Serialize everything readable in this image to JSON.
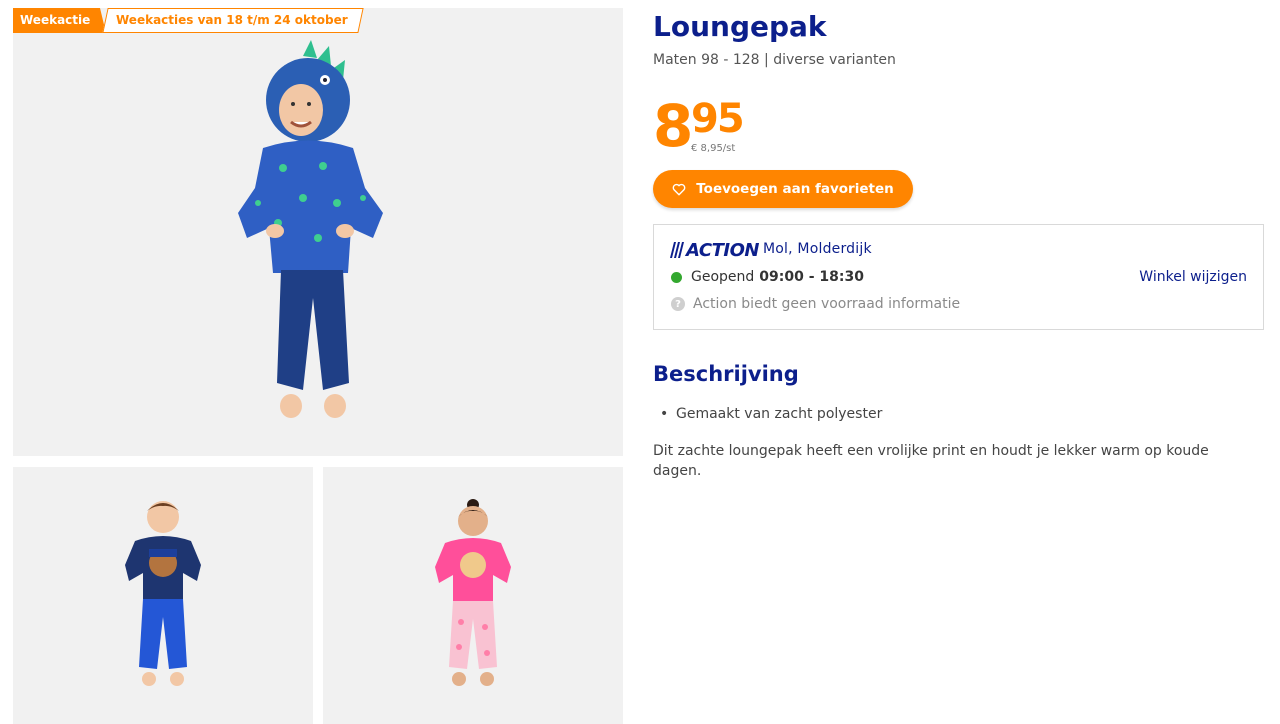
{
  "badges": {
    "weekactie": "Weekactie",
    "dates": "Weekacties van 18 t/m 24 oktober"
  },
  "product": {
    "title": "Loungepak",
    "subtitle": "Maten 98 - 128 | diverse varianten",
    "price_euros": "8",
    "price_cents": "95",
    "unit_price": "€ 8,95/st",
    "favorite_label": "Toevoegen aan favorieten"
  },
  "store": {
    "brand": "ACTION",
    "name": "Mol, Molderdijk",
    "status": "Geopend",
    "hours": "09:00 - 18:30",
    "change_label": "Winkel wijzigen",
    "stock_info": "Action biedt geen voorraad informatie"
  },
  "description": {
    "title": "Beschrijving",
    "bullets": [
      "Gemaakt van zacht polyester"
    ],
    "text": "Dit zachte loungepak heeft een vrolijke print en houdt je lekker warm op koude dagen."
  },
  "colors": {
    "accent": "#ff8500",
    "brand": "#0c1f8c",
    "open": "#34a82f"
  },
  "icons": {
    "favorite": "heart-outline-icon",
    "stock": "question-circle-icon",
    "open_status": "green-dot-icon"
  }
}
